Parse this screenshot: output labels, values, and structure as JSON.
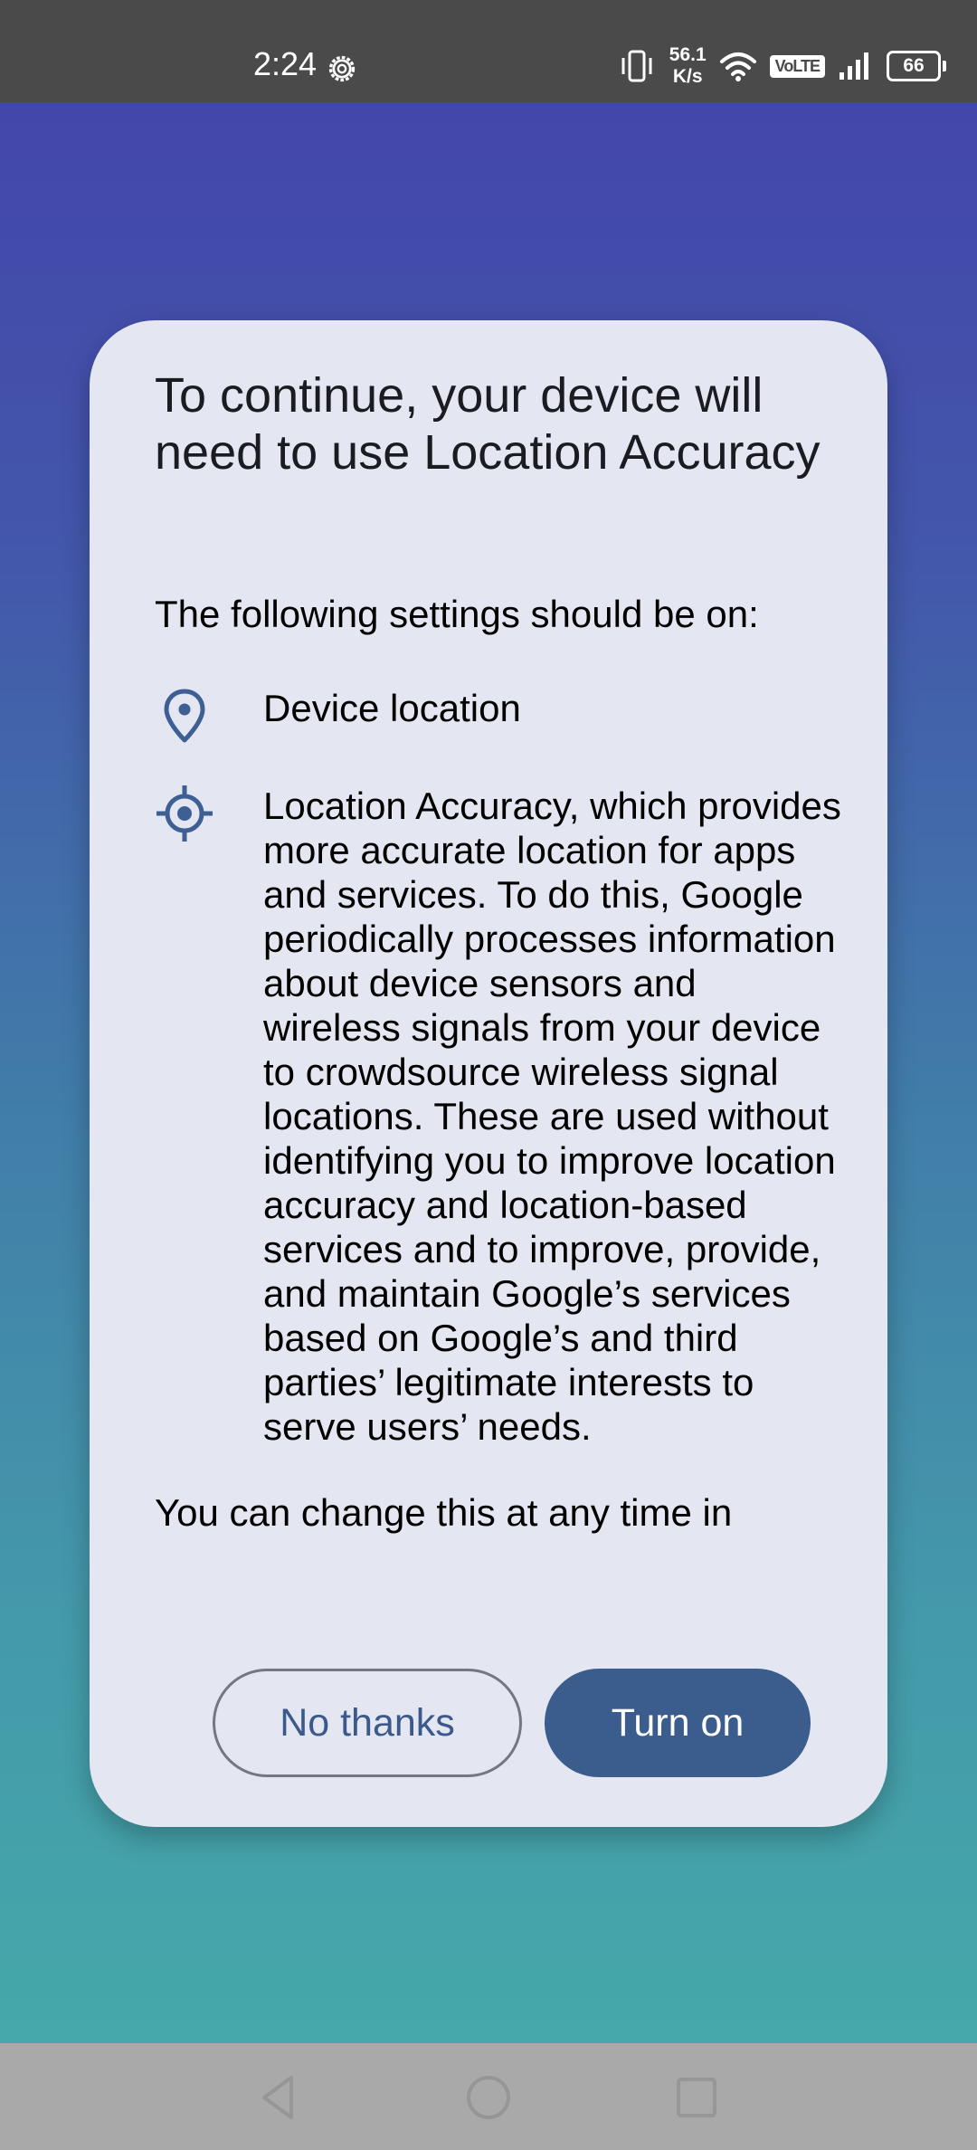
{
  "status_bar": {
    "time": "2:24",
    "net_speed_value": "56.1",
    "net_speed_unit": "K/s",
    "volte": "VoLTE",
    "battery": "66",
    "icons": [
      "settings-gear-icon",
      "vibrate-icon",
      "wifi-icon",
      "volte-icon",
      "signal-icon",
      "battery-icon"
    ]
  },
  "dialog": {
    "title": "To continue, your device will need to use Location Accuracy",
    "subheading": "The following settings should be on:",
    "items": [
      {
        "icon": "location-pin-icon",
        "text": "Device location"
      },
      {
        "icon": "gps-target-icon",
        "text": "Location Accuracy, which provides more accurate location for apps and services. To do this, Google periodically processes information about device sensors and wireless signals from your device to crowdsource wireless signal locations. These are used without identifying you to improve location accuracy and location-based services and to improve, provide, and maintain Google’s services based on Google’s and third parties’ legitimate interests to serve users’ needs."
      }
    ],
    "footer_text": "You can change this at any time in",
    "buttons": {
      "decline": "No thanks",
      "accept": "Turn on"
    }
  },
  "colors": {
    "accent": "#3b5d8e",
    "dialog_background": "#e4e6f1",
    "status_bar": "#4a4a4a",
    "nav_bar": "#a9a9a9"
  },
  "nav_bar": {
    "icons": [
      "back-icon",
      "home-icon",
      "recent-apps-icon"
    ]
  }
}
